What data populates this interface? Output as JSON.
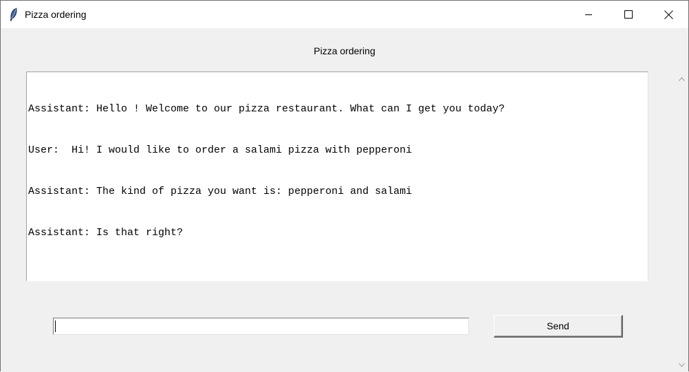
{
  "window": {
    "title": "Pizza ordering",
    "app_icon": "feather-icon",
    "controls": [
      "minimize-icon",
      "maximize-icon",
      "close-icon"
    ]
  },
  "header": {
    "label": "Pizza ordering"
  },
  "chat": {
    "lines": [
      "Assistant: Hello ! Welcome to our pizza restaurant. What can I get you today?",
      "User:  Hi! I would like to order a salami pizza with pepperoni",
      "Assistant: The kind of pizza you want is: pepperoni and salami",
      "Assistant: Is that right?"
    ]
  },
  "input": {
    "value": "",
    "placeholder": ""
  },
  "send_button": {
    "label": "Send"
  },
  "colors": {
    "window_bg": "#f0f0f0",
    "titlebar_bg": "#ffffff",
    "text": "#000000"
  }
}
